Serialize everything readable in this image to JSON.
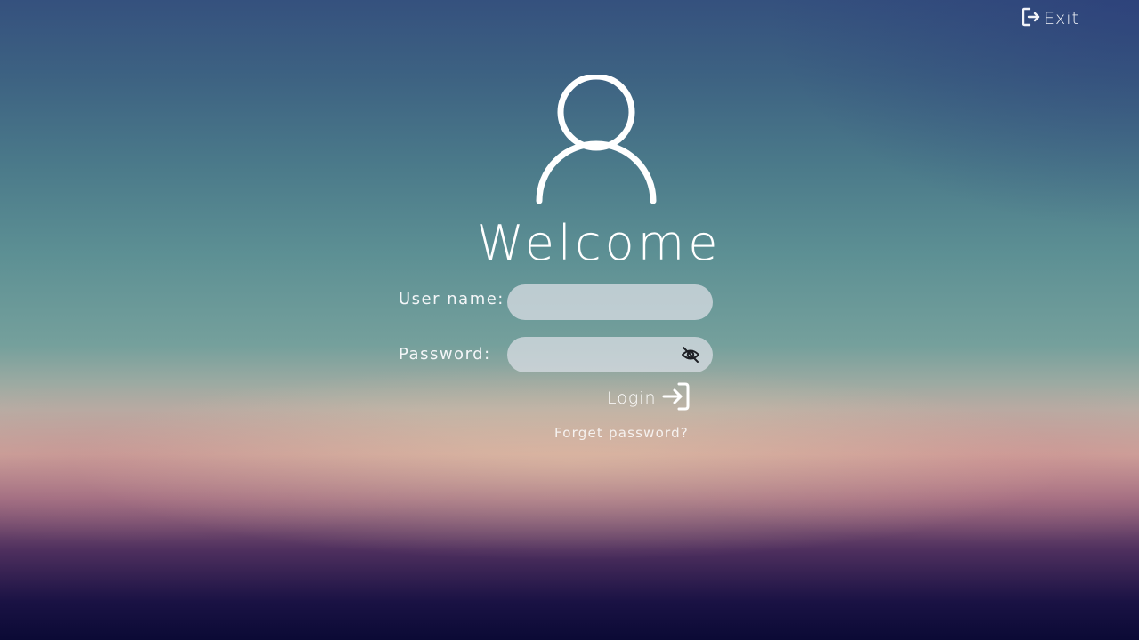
{
  "header": {
    "exit_label": "Exit",
    "exit_icon": "logout-icon"
  },
  "hero": {
    "avatar_icon": "user-icon",
    "title": "Welcome"
  },
  "form": {
    "username_label": "User name:",
    "username_value": "",
    "username_placeholder": "",
    "password_label": "Password:",
    "password_value": "",
    "password_placeholder": "",
    "password_toggle_icon": "eye-slash-icon",
    "login_label": "Login",
    "login_icon": "login-icon",
    "forget_label": "Forget password?"
  },
  "colors": {
    "text": "#ffffff",
    "input_fill": "#d6dbe2"
  }
}
